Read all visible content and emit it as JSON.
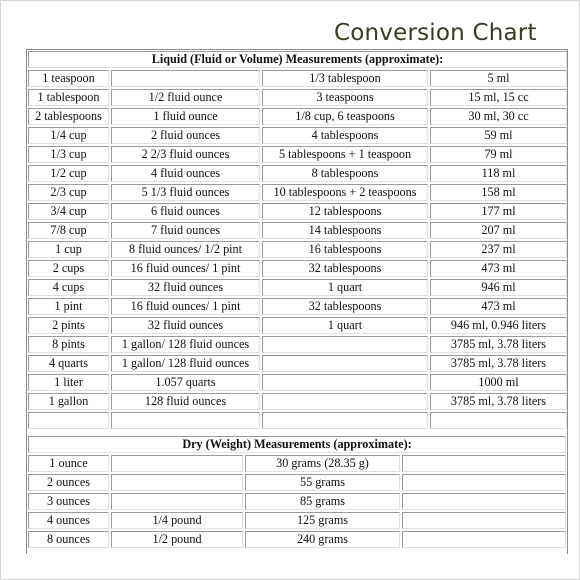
{
  "title": "Conversion Chart",
  "liquid": {
    "heading": "Liquid (Fluid or Volume) Measurements (approximate):",
    "rows": [
      [
        "1 teaspoon",
        "",
        "1/3 tablespoon",
        "5 ml"
      ],
      [
        "1 tablespoon",
        "1/2 fluid ounce",
        "3 teaspoons",
        "15 ml, 15 cc"
      ],
      [
        "2 tablespoons",
        "1 fluid ounce",
        "1/8 cup, 6 teaspoons",
        "30 ml, 30 cc"
      ],
      [
        "1/4 cup",
        "2 fluid ounces",
        "4 tablespoons",
        "59 ml"
      ],
      [
        "1/3 cup",
        "2 2/3 fluid ounces",
        "5 tablespoons + 1 teaspoon",
        "79 ml"
      ],
      [
        "1/2 cup",
        "4 fluid ounces",
        "8 tablespoons",
        "118 ml"
      ],
      [
        "2/3 cup",
        "5 1/3 fluid ounces",
        "10 tablespoons + 2 teaspoons",
        "158 ml"
      ],
      [
        "3/4 cup",
        "6 fluid ounces",
        "12 tablespoons",
        "177 ml"
      ],
      [
        "7/8 cup",
        "7 fluid ounces",
        "14 tablespoons",
        "207 ml"
      ],
      [
        "1 cup",
        "8 fluid ounces/ 1/2 pint",
        "16 tablespoons",
        "237 ml"
      ],
      [
        "2 cups",
        "16 fluid ounces/ 1 pint",
        "32 tablespoons",
        "473 ml"
      ],
      [
        "4 cups",
        "32 fluid ounces",
        "1 quart",
        "946 ml"
      ],
      [
        "1 pint",
        "16 fluid ounces/ 1 pint",
        "32 tablespoons",
        "473 ml"
      ],
      [
        "2 pints",
        "32 fluid ounces",
        "1 quart",
        "946 ml,  0.946 liters"
      ],
      [
        "8 pints",
        "1 gallon/ 128 fluid ounces",
        "",
        "3785 ml,  3.78 liters"
      ],
      [
        "4 quarts",
        "1 gallon/ 128 fluid ounces",
        "",
        "3785 ml,  3.78 liters"
      ],
      [
        "1 liter",
        "1.057 quarts",
        "",
        "1000 ml"
      ],
      [
        "1 gallon",
        "128 fluid ounces",
        "",
        "3785 ml,  3.78 liters"
      ],
      [
        "",
        "",
        "",
        ""
      ]
    ]
  },
  "dry": {
    "heading": "Dry (Weight) Measurements (approximate):",
    "rows": [
      [
        "1 ounce",
        "",
        "30 grams  (28.35 g)",
        ""
      ],
      [
        "2 ounces",
        "",
        "55 grams",
        ""
      ],
      [
        "3 ounces",
        "",
        "85 grams",
        ""
      ],
      [
        "4 ounces",
        "1/4 pound",
        "125 grams",
        ""
      ],
      [
        "8 ounces",
        "1/2 pound",
        "240 grams",
        ""
      ]
    ]
  }
}
